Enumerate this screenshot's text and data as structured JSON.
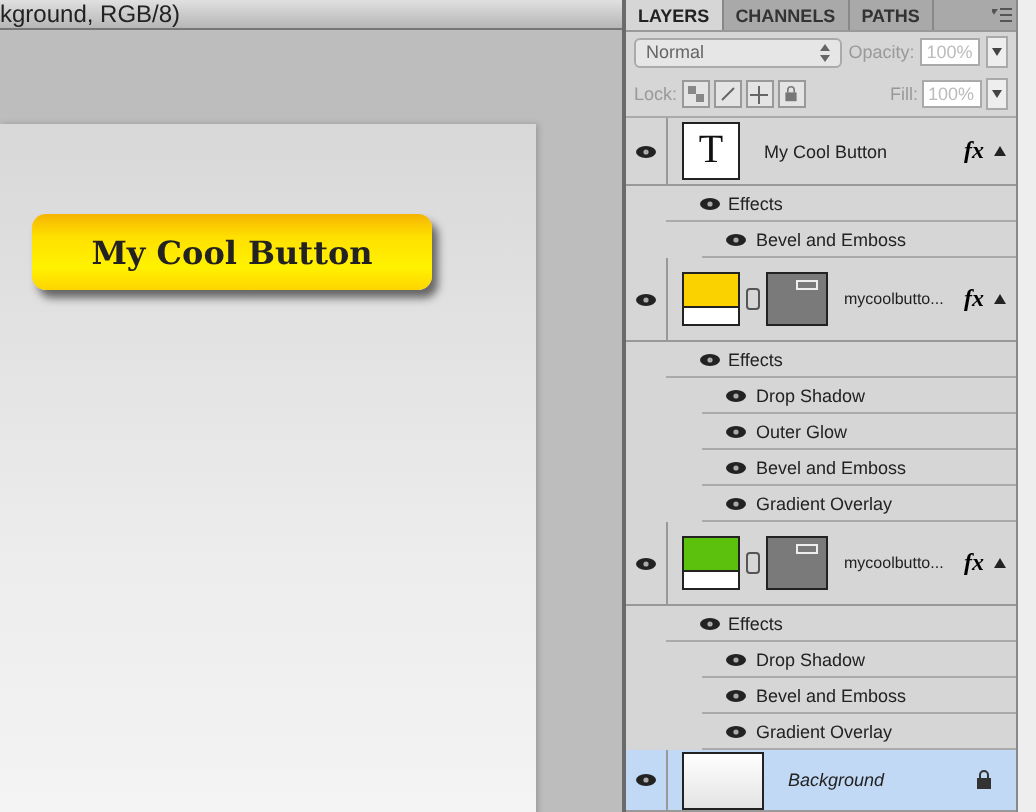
{
  "document_tab": {
    "title": "kground, RGB/8)"
  },
  "canvas": {
    "button_text": "My Cool Button"
  },
  "panel": {
    "tabs": [
      {
        "label": "LAYERS",
        "selected": true
      },
      {
        "label": "CHANNELS",
        "selected": false
      },
      {
        "label": "PATHS",
        "selected": false
      }
    ],
    "blend_mode": "Normal",
    "opacity_label": "Opacity:",
    "opacity": "100%",
    "lock_label": "Lock:",
    "fill_label": "Fill:",
    "fill": "100%",
    "layers": [
      {
        "kind": "text",
        "thumb": "T",
        "name": "My Cool Button",
        "fx": "fx",
        "selected": false,
        "locked": false,
        "visible": true,
        "effects_label": "Effects",
        "effects": [
          "Bevel and Emboss"
        ]
      },
      {
        "kind": "shape",
        "color": "#f9d200",
        "name": "mycoolbutto...",
        "fx": "fx",
        "selected": false,
        "locked": false,
        "visible": true,
        "effects_label": "Effects",
        "effects": [
          "Drop Shadow",
          "Outer Glow",
          "Bevel and Emboss",
          "Gradient Overlay"
        ]
      },
      {
        "kind": "shape",
        "color": "#5cc10c",
        "name": "mycoolbutto...",
        "fx": "fx",
        "selected": false,
        "locked": false,
        "visible": true,
        "effects_label": "Effects",
        "effects": [
          "Drop Shadow",
          "Bevel and Emboss",
          "Gradient Overlay"
        ]
      },
      {
        "kind": "background",
        "name": "Background",
        "selected": true,
        "locked": true,
        "visible": true
      }
    ]
  }
}
